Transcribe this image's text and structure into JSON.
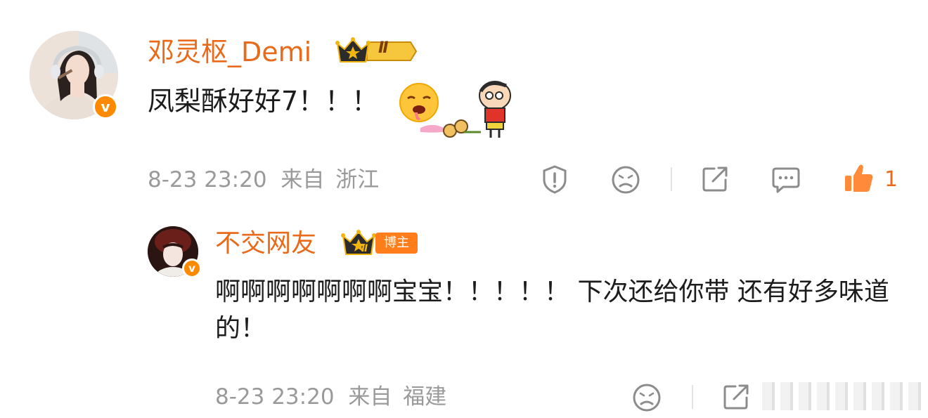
{
  "comment": {
    "username": "邓灵枢_Demi",
    "level_badge": "Ⅱ",
    "text": "凤梨酥好好7！！！",
    "time": "8-23 23:20",
    "from_label": "来自",
    "location": "浙江",
    "like_count": "1",
    "icons": [
      "report-icon",
      "dislike-icon",
      "share-icon",
      "reply-icon",
      "like-icon"
    ]
  },
  "reply": {
    "username": "不交网友",
    "level_badge": "Ⅱ",
    "role_badge": "博主",
    "text": "啊啊啊啊啊啊啊宝宝！！！！！ 下次还给你带 还有好多味道的！",
    "time": "8-23 23:20",
    "from_label": "来自",
    "location": "福建",
    "icons": [
      "dislike-icon",
      "share-icon"
    ]
  },
  "colors": {
    "accent": "#e86a1a",
    "verified": "#ff8a00",
    "meta_gray": "#9a9a9a",
    "crown_gold": "#f2b40f",
    "crown_dark": "#2b2b2b"
  }
}
